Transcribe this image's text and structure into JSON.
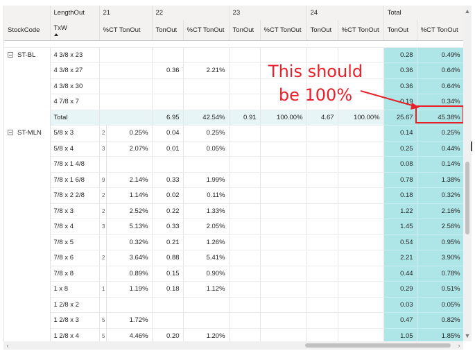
{
  "matrix": {
    "col_headers": {
      "length_out_label": "LengthOut",
      "groups": [
        "21",
        "22",
        "23",
        "24",
        "Total"
      ],
      "stock_code_label": "StockCode",
      "txw_label": "TxW",
      "measure_ton": "TonOut",
      "measure_pct": "%CT TonOut"
    },
    "groups": [
      {
        "stock_code": "ST-BL",
        "rows": [
          {
            "txw": "4 3/8 x 23",
            "c21": "",
            "t22": "",
            "p22": "",
            "t23": "",
            "p23": "",
            "t24": "",
            "p24": "",
            "tt": "0.28",
            "tp": "0.49%"
          },
          {
            "txw": "4 3/8 x 27",
            "c21": "",
            "t22": "0.36",
            "p22": "2.21%",
            "t23": "",
            "p23": "",
            "t24": "",
            "p24": "",
            "tt": "0.36",
            "tp": "0.64%"
          },
          {
            "txw": "4 3/8 x 30",
            "c21": "",
            "t22": "",
            "p22": "",
            "t23": "",
            "p23": "",
            "t24": "",
            "p24": "",
            "tt": "0.36",
            "tp": "0.64%"
          },
          {
            "txw": "4 7/8 x 7",
            "c21": "",
            "t22": "",
            "p22": "",
            "t23": "",
            "p23": "",
            "t24": "",
            "p24": "",
            "tt": "0.19",
            "tp": "0.34%"
          }
        ],
        "total": {
          "label": "Total",
          "t22": "6.95",
          "p22": "42.54%",
          "t23": "0.91",
          "p23": "100.00%",
          "t24": "4.67",
          "p24": "100.00%",
          "tt": "25.67",
          "tp": "45.38%"
        }
      },
      {
        "stock_code": "ST-MLN",
        "rows": [
          {
            "txw": "5/8 x 3",
            "cut": "2",
            "c21": "0.25%",
            "t22": "0.04",
            "p22": "0.25%",
            "tt": "0.14",
            "tp": "0.25%"
          },
          {
            "txw": "5/8 x 4",
            "cut": "3",
            "c21": "2.07%",
            "t22": "0.01",
            "p22": "0.05%",
            "tt": "0.25",
            "tp": "0.44%"
          },
          {
            "txw": "7/8 x 1 4/8",
            "cut": "",
            "c21": "",
            "t22": "",
            "p22": "",
            "tt": "0.08",
            "tp": "0.14%"
          },
          {
            "txw": "7/8 x 1 6/8",
            "cut": "9",
            "c21": "2.14%",
            "t22": "0.33",
            "p22": "1.99%",
            "tt": "0.78",
            "tp": "1.38%"
          },
          {
            "txw": "7/8 x 2 2/8",
            "cut": "2",
            "c21": "1.14%",
            "t22": "0.02",
            "p22": "0.11%",
            "tt": "0.18",
            "tp": "0.32%"
          },
          {
            "txw": "7/8 x 3",
            "cut": "2",
            "c21": "2.52%",
            "t22": "0.22",
            "p22": "1.33%",
            "tt": "1.22",
            "tp": "2.16%"
          },
          {
            "txw": "7/8 x 4",
            "cut": "3",
            "c21": "5.13%",
            "t22": "0.33",
            "p22": "2.05%",
            "tt": "1.45",
            "tp": "2.56%"
          },
          {
            "txw": "7/8 x 5",
            "cut": "",
            "c21": "0.32%",
            "t22": "0.21",
            "p22": "1.26%",
            "tt": "0.54",
            "tp": "0.95%"
          },
          {
            "txw": "7/8 x 6",
            "cut": "2",
            "c21": "3.64%",
            "t22": "0.88",
            "p22": "5.41%",
            "tt": "2.21",
            "tp": "3.90%"
          },
          {
            "txw": "7/8 x 8",
            "cut": "",
            "c21": "0.89%",
            "t22": "0.15",
            "p22": "0.90%",
            "tt": "0.44",
            "tp": "0.78%"
          },
          {
            "txw": "1 x 8",
            "cut": "1",
            "c21": "1.19%",
            "t22": "0.18",
            "p22": "1.12%",
            "tt": "0.29",
            "tp": "0.51%"
          },
          {
            "txw": "1 2/8 x 2",
            "cut": "",
            "c21": "",
            "t22": "",
            "p22": "",
            "tt": "0.03",
            "tp": "0.05%"
          },
          {
            "txw": "1 2/8 x 3",
            "cut": "5",
            "c21": "1.72%",
            "t22": "",
            "p22": "",
            "tt": "0.47",
            "tp": "0.82%"
          },
          {
            "txw": "1 2/8 x 4",
            "cut": "5",
            "c21": "4.46%",
            "t22": "0.20",
            "p22": "1.20%",
            "tt": "1.05",
            "tp": "1.85%"
          }
        ]
      }
    ]
  },
  "annotation": {
    "line1": "This should",
    "line2": "be 100%",
    "color": "#e8202a"
  },
  "colors": {
    "total_column_bg": "#aee6e8",
    "subtotal_row_bg": "#e7f5f6",
    "header_bg": "#f3f2f1"
  }
}
